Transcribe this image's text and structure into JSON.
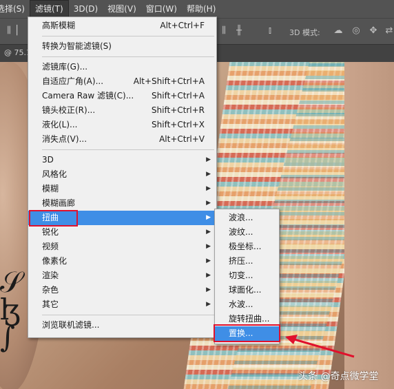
{
  "menubar": {
    "items": [
      {
        "label": "选择(S)"
      },
      {
        "label": "滤镜(T)",
        "active": true
      },
      {
        "label": "3D(D)"
      },
      {
        "label": "视图(V)"
      },
      {
        "label": "窗口(W)"
      },
      {
        "label": "帮助(H)"
      }
    ]
  },
  "options_bar": {
    "mode_label": "3D 模式:"
  },
  "tab": {
    "title": "@ 75.1"
  },
  "filter_menu": {
    "items": [
      {
        "label": "高斯模糊",
        "shortcut": "Alt+Ctrl+F"
      },
      {
        "label": "转换为智能滤镜(S)",
        "shortcut": ""
      },
      {
        "label": "滤镜库(G)...",
        "shortcut": ""
      },
      {
        "label": "自适应广角(A)...",
        "shortcut": "Alt+Shift+Ctrl+A"
      },
      {
        "label": "Camera Raw 滤镜(C)...",
        "shortcut": "Shift+Ctrl+A"
      },
      {
        "label": "镜头校正(R)...",
        "shortcut": "Shift+Ctrl+R"
      },
      {
        "label": "液化(L)...",
        "shortcut": "Shift+Ctrl+X"
      },
      {
        "label": "消失点(V)...",
        "shortcut": "Alt+Ctrl+V"
      },
      {
        "label": "3D",
        "submenu": true
      },
      {
        "label": "风格化",
        "submenu": true
      },
      {
        "label": "模糊",
        "submenu": true
      },
      {
        "label": "模糊画廊",
        "submenu": true
      },
      {
        "label": "扭曲",
        "submenu": true,
        "highlighted": true
      },
      {
        "label": "锐化",
        "submenu": true
      },
      {
        "label": "视频",
        "submenu": true
      },
      {
        "label": "像素化",
        "submenu": true
      },
      {
        "label": "渲染",
        "submenu": true
      },
      {
        "label": "杂色",
        "submenu": true
      },
      {
        "label": "其它",
        "submenu": true
      },
      {
        "label": "浏览联机滤镜...",
        "shortcut": ""
      }
    ]
  },
  "distort_submenu": {
    "items": [
      {
        "label": "波浪..."
      },
      {
        "label": "波纹..."
      },
      {
        "label": "极坐标..."
      },
      {
        "label": "挤压..."
      },
      {
        "label": "切变..."
      },
      {
        "label": "球面化..."
      },
      {
        "label": "水波..."
      },
      {
        "label": "旋转扭曲..."
      },
      {
        "label": "置换...",
        "highlighted": true
      }
    ]
  },
  "watermark": {
    "text": "头条 @奇点微学堂"
  },
  "colors": {
    "highlight": "#3f8ee6",
    "annotation_red": "#e0102c",
    "menu_bg": "#f0f0f0",
    "chrome_bg": "#535353"
  }
}
